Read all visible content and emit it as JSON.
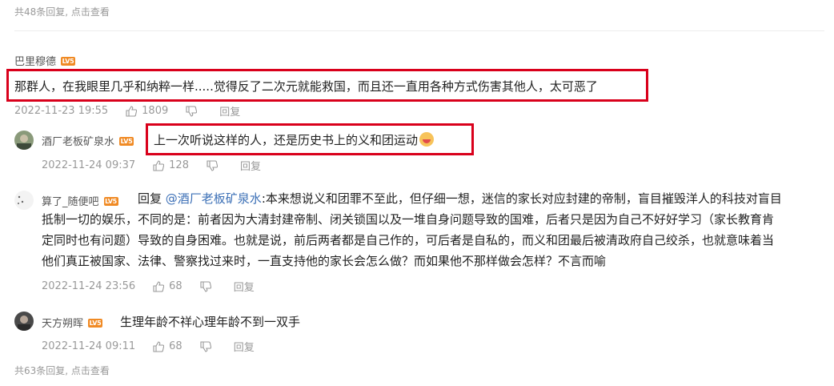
{
  "top_more": "共48条回复, 点击查看",
  "bottom_more": "共63条回复, 点击查看",
  "level_badge": "LV5",
  "comments": [
    {
      "user": "巴里穆德",
      "content": "那群人，在我眼里几乎和纳粹一样.....觉得反了二次元就能救国，而且还一直用各种方式伤害其他人，太可恶了",
      "time": "2022-11-23 19:55",
      "likes": "1809",
      "reply_label": "回复"
    },
    {
      "user": "酒厂老板矿泉水",
      "content": "上一次听说这样的人，还是历史书上的义和团运动",
      "time": "2022-11-24 09:37",
      "likes": "128",
      "reply_label": "回复"
    },
    {
      "user": "算了_随便吧",
      "reply_prefix": "回复",
      "mention": "@酒厂老板矿泉水",
      "lines": [
        ":本来想说义和团罪不至此，但仔细一想，迷信的家长对应封建的帝制，盲目摧毁洋人的科技对盲目",
        "抵制一切的娱乐，不同的是：前者因为大清封建帝制、闭关锁国以及一堆自身问题导致的国难，后者只是因为自己不好好学习（家长教育肯",
        "定同时也有问题）导致的自身困难。也就是说，前后两者都是自己作的，可后者是自私的，而义和团最后被清政府自己绞杀，也就意味着当",
        "他们真正被国家、法律、警察找过来时，一直支持他的家长会怎么做？而如果他不那样做会怎样？不言而喻"
      ],
      "time": "2022-11-24 23:56",
      "likes": "68",
      "reply_label": "回复"
    },
    {
      "user": "天方朔晖",
      "content": "生理年龄不祥心理年龄不到一双手",
      "time": "2022-11-24 09:11",
      "likes": "68",
      "reply_label": "回复"
    }
  ],
  "colors": {
    "highlight_box": "#d9001b",
    "link": "#3b6fb6",
    "badge": "#f08a24"
  }
}
